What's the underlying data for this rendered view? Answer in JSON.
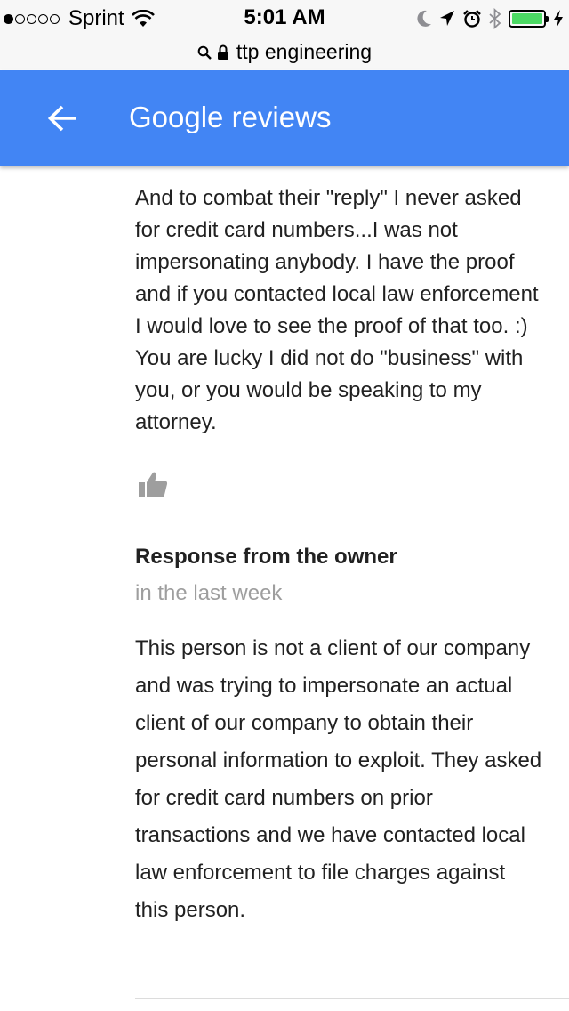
{
  "status_bar": {
    "carrier": "Sprint",
    "time": "5:01 AM",
    "signal_bars_filled": 1,
    "signal_bars_total": 5,
    "battery_level": 1.0,
    "battery_color": "#4cd964"
  },
  "url_bar": {
    "url": "ttp engineering"
  },
  "app_bar": {
    "title": "Google reviews",
    "color": "#4285f4"
  },
  "review": {
    "text": "And to combat their \"reply\" I never asked for credit card numbers...I was not impersonating anybody. I have the proof and if you contacted local law enforcement I would love to see the proof of that too. :) You are lucky I did not do \"business\" with you, or you would be speaking to my attorney."
  },
  "owner_response": {
    "heading": "Response from the owner",
    "time": "in the last week",
    "text": "This person is not a client of our company and was trying to impersonate an actual client of our company to obtain their personal information to exploit. They asked for credit card numbers on prior transactions and we have contacted local law enforcement to file charges against this person."
  }
}
